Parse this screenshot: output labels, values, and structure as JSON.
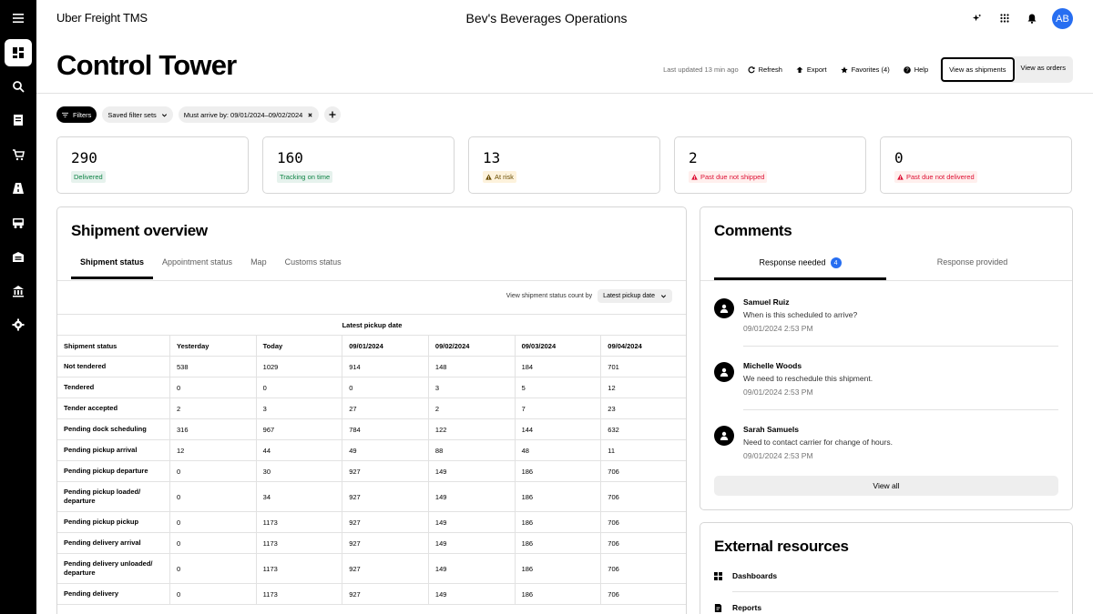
{
  "app": {
    "name": "Uber Freight TMS",
    "org": "Bev's Beverages Operations",
    "user_initials": "AB"
  },
  "icons": {
    "rail": [
      "menu-icon",
      "dashboard-icon",
      "search-icon",
      "list-icon",
      "cart-icon",
      "road-icon",
      "truck-icon",
      "warehouse-icon",
      "bank-icon",
      "gear-icon"
    ],
    "top": [
      "sparkle-icon",
      "grid-icon",
      "bell-icon"
    ]
  },
  "page": {
    "title": "Control Tower",
    "last_updated": "Last updated 13 min ago",
    "refresh": "Refresh",
    "export": "Export",
    "favorites": "Favorites (4)",
    "help": "Help",
    "view_shipments": "View as shipments",
    "view_orders": "View as orders"
  },
  "filters": {
    "filters_label": "Filters",
    "saved_sets": "Saved filter sets",
    "must_arrive": "Must arrive by: 09/01/2024–09/02/2024"
  },
  "stats": [
    {
      "value": "290",
      "label": "Delivered",
      "tone": "green"
    },
    {
      "value": "160",
      "label": "Tracking on time",
      "tone": "green"
    },
    {
      "value": "13",
      "label": "At risk",
      "tone": "yellow"
    },
    {
      "value": "2",
      "label": "Past due not shipped",
      "tone": "red"
    },
    {
      "value": "0",
      "label": "Past due not delivered",
      "tone": "red"
    }
  ],
  "overview": {
    "title": "Shipment overview",
    "tabs": [
      "Shipment status",
      "Appointment status",
      "Map",
      "Customs status"
    ],
    "count_by_label": "View shipment status count by",
    "count_by_value": "Latest pickup date",
    "table_caption": "Latest pickup date",
    "columns": [
      "Shipment status",
      "Yesterday",
      "Today",
      "09/01/2024",
      "09/02/2024",
      "09/03/2024",
      "09/04/2024"
    ],
    "rows": [
      {
        "status": "Not tendered",
        "cells": [
          "538",
          "1029",
          "914",
          "148",
          "184",
          "701"
        ]
      },
      {
        "status": "Tendered",
        "cells": [
          "0",
          "0",
          "0",
          "3",
          "5",
          "12"
        ]
      },
      {
        "status": "Tender accepted",
        "cells": [
          "2",
          "3",
          "27",
          "2",
          "7",
          "23"
        ]
      },
      {
        "status": "Pending dock scheduling",
        "cells": [
          "316",
          "967",
          "784",
          "122",
          "144",
          "632"
        ]
      },
      {
        "status": "Pending pickup arrival",
        "cells": [
          "12",
          "44",
          "49",
          "88",
          "48",
          "11"
        ]
      },
      {
        "status": "Pending pickup departure",
        "cells": [
          "0",
          "30",
          "927",
          "149",
          "186",
          "706"
        ]
      },
      {
        "status": "Pending pickup loaded/ departure",
        "cells": [
          "0",
          "34",
          "927",
          "149",
          "186",
          "706"
        ]
      },
      {
        "status": "Pending pickup pickup",
        "cells": [
          "0",
          "1173",
          "927",
          "149",
          "186",
          "706"
        ]
      },
      {
        "status": "Pending delivery arrival",
        "cells": [
          "0",
          "1173",
          "927",
          "149",
          "186",
          "706"
        ]
      },
      {
        "status": "Pending delivery unloaded/ departure",
        "cells": [
          "0",
          "1173",
          "927",
          "149",
          "186",
          "706"
        ]
      },
      {
        "status": "Pending delivery",
        "cells": [
          "0",
          "1173",
          "927",
          "149",
          "186",
          "706"
        ]
      }
    ]
  },
  "comments": {
    "title": "Comments",
    "tab_needed": "Response needed",
    "needed_count": "4",
    "tab_provided": "Response provided",
    "items": [
      {
        "name": "Samuel Ruiz",
        "message": "When is this scheduled to arrive?",
        "time": "09/01/2024 2:53 PM"
      },
      {
        "name": "Michelle Woods",
        "message": "We need to reschedule this shipment.",
        "time": "09/01/2024 2:53 PM"
      },
      {
        "name": "Sarah Samuels",
        "message": "Need to contact carrier for change of hours.",
        "time": "09/01/2024 2:53 PM"
      }
    ],
    "view_all": "View all"
  },
  "resources": {
    "title": "External resources",
    "items": [
      "Dashboards",
      "Reports"
    ]
  }
}
